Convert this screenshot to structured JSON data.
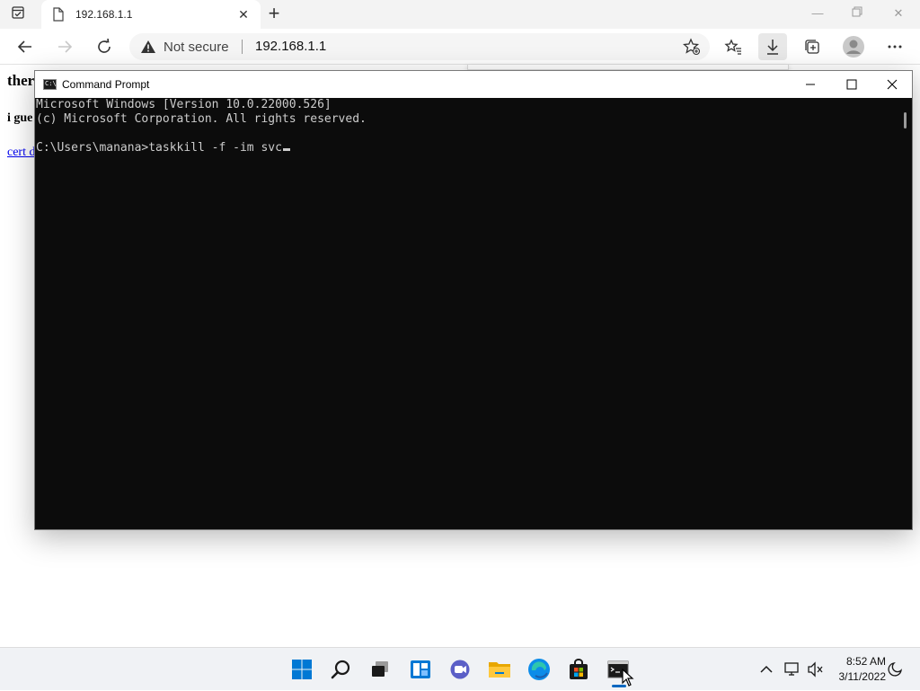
{
  "browser": {
    "tab_title": "192.168.1.1",
    "security_label": "Not secure",
    "url": "192.168.1.1"
  },
  "page": {
    "heading": "ther",
    "subheading": "i gue",
    "link": "cert d"
  },
  "cmd": {
    "title": "Command Prompt",
    "lines": [
      "Microsoft Windows [Version 10.0.22000.526]",
      "(c) Microsoft Corporation. All rights reserved.",
      "",
      "C:\\Users\\manana>taskkill -f -im svc"
    ]
  },
  "taskbar": {
    "time": "8:52 AM",
    "date": "3/11/2022",
    "apps": [
      "start",
      "search",
      "task-view",
      "widgets",
      "chat",
      "file-explorer",
      "edge",
      "store",
      "command-prompt"
    ]
  },
  "colors": {
    "console_bg": "#0c0c0c",
    "console_fg": "#cccccc",
    "accent": "#0067c0"
  }
}
